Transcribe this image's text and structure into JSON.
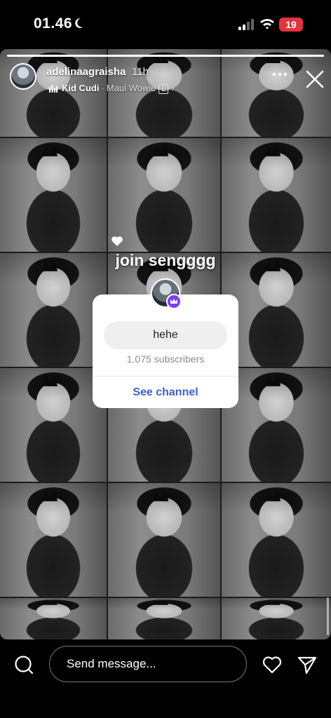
{
  "status_bar": {
    "time": "01.46",
    "battery": "19",
    "icons": [
      "moon-icon",
      "signal-icon",
      "wifi-icon",
      "battery-icon"
    ]
  },
  "story": {
    "progress": 1.0,
    "username": "adelinaagraisha",
    "time_ago": "11h",
    "music": {
      "artist": "Kid Cudi",
      "separator": "·",
      "song": "Maui Wowie",
      "explicit": "E"
    },
    "sticker_title": "join sengggg",
    "channel_card": {
      "name": "hehe",
      "subscribers": "1.075 subscribers",
      "action": "See channel"
    }
  },
  "bottom_bar": {
    "message_placeholder": "Send message..."
  },
  "colors": {
    "accent": "#3f5fc7",
    "badge": "#7a3ff2",
    "battery": "#e0353d"
  }
}
